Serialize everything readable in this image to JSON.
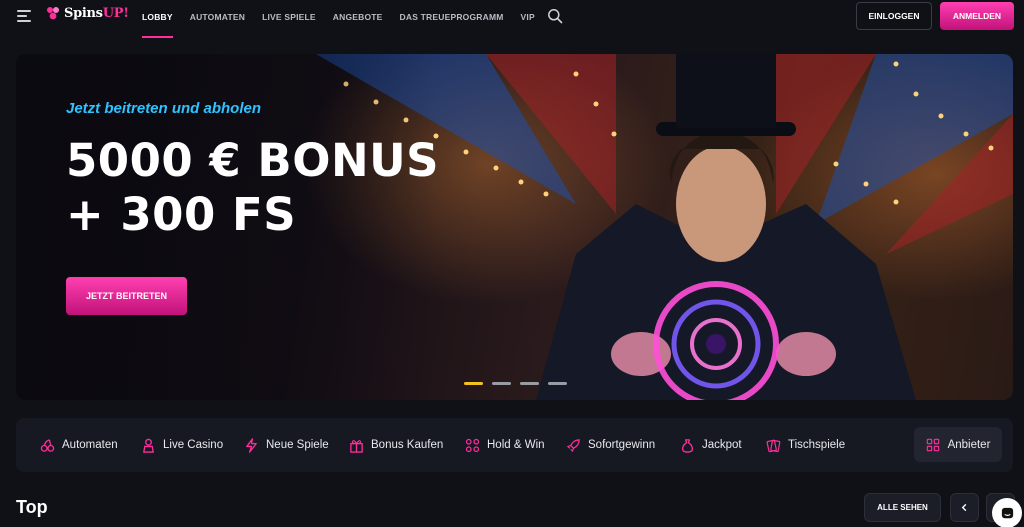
{
  "header": {
    "logo_text": "Spins",
    "logo_accent": "UP!",
    "nav": [
      {
        "label": "LOBBY",
        "active": true
      },
      {
        "label": "AUTOMATEN",
        "active": false
      },
      {
        "label": "LIVE SPIELE",
        "active": false
      },
      {
        "label": "ANGEBOTE",
        "active": false
      },
      {
        "label": "DAS TREUEPROGRAMM",
        "active": false
      },
      {
        "label": "VIP",
        "active": false
      }
    ],
    "login_label": "EINLOGGEN",
    "register_label": "ANMELDEN"
  },
  "hero": {
    "subtitle": "Jetzt beitreten und abholen",
    "title_line1": "5000 € BONUS",
    "title_line2": "+ 300 FS",
    "cta_label": "JETZT BEITRETEN",
    "slides_total": 4,
    "slide_active": 1
  },
  "categories": [
    {
      "label": "Automaten",
      "icon": "cherries-icon"
    },
    {
      "label": "Live Casino",
      "icon": "dealer-icon"
    },
    {
      "label": "Neue Spiele",
      "icon": "lightning-icon"
    },
    {
      "label": "Bonus Kaufen",
      "icon": "gift-icon"
    },
    {
      "label": "Hold & Win",
      "icon": "coins-icon"
    },
    {
      "label": "Sofortgewinn",
      "icon": "rocket-icon"
    },
    {
      "label": "Jackpot",
      "icon": "money-bag-icon"
    },
    {
      "label": "Tischspiele",
      "icon": "cards-icon"
    }
  ],
  "providers_label": "Anbieter",
  "top": {
    "title": "Top",
    "see_all_label": "ALLE SEHEN"
  },
  "colors": {
    "accent": "#ff2e9a",
    "hero_subtitle": "#2fc3ff",
    "active_dot": "#f2c31a",
    "background": "#0f1116"
  }
}
